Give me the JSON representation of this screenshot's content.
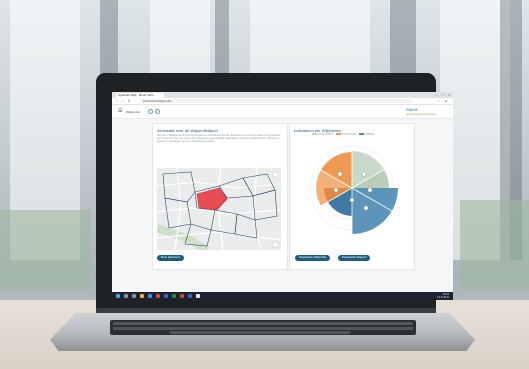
{
  "browser": {
    "tab_title": "Optimale Wijk - Buurt indic...",
    "address": "buurtzelf.nl/wijkprofiel",
    "window_controls": [
      "–",
      "□",
      "×"
    ]
  },
  "app_header": {
    "menu_icon": "hamburger-icon",
    "title": "Wijkprofiel",
    "logo_line1": "Wijkzelf",
    "logo_line2": "gebiedsgericht werken"
  },
  "left_panel": {
    "title": "Informatie over de Wijkprofielbuurt",
    "text": "Hier kunt u bekijken hoe de buurt ervoor staat op verschillende thema's. Selecteer een buurt op de kaart om de gegevens van die buurt te tonen. De scores zijn gebaseerd op gemeentelijke registraties en enquêtes onder bewoners. Klik op een segment in het diagram voor een toelichting per indicator.",
    "button_label": "Buurt Selecteren"
  },
  "right_panel": {
    "title": "Indicatoren per Wijkthema",
    "legend": [
      {
        "label": "Fysieke kwaliteit",
        "color": "#c9d9c9"
      },
      {
        "label": "Sociale kwaliteit",
        "color": "#ee9a52"
      },
      {
        "label": "Veiligheid",
        "color": "#4b88b0"
      }
    ],
    "button1_label": "Downloaden Wijkprofiel",
    "button2_label": "Downloaden Rapport"
  },
  "taskbar": {
    "time": "10:24",
    "date": "14-5-2021"
  },
  "colors": {
    "brand_blue": "#1f5d80",
    "map_highlight": "#e8323c",
    "orange": "#ee9a52",
    "steel_blue": "#4b88b0",
    "sage": "#c9d9c9"
  }
}
